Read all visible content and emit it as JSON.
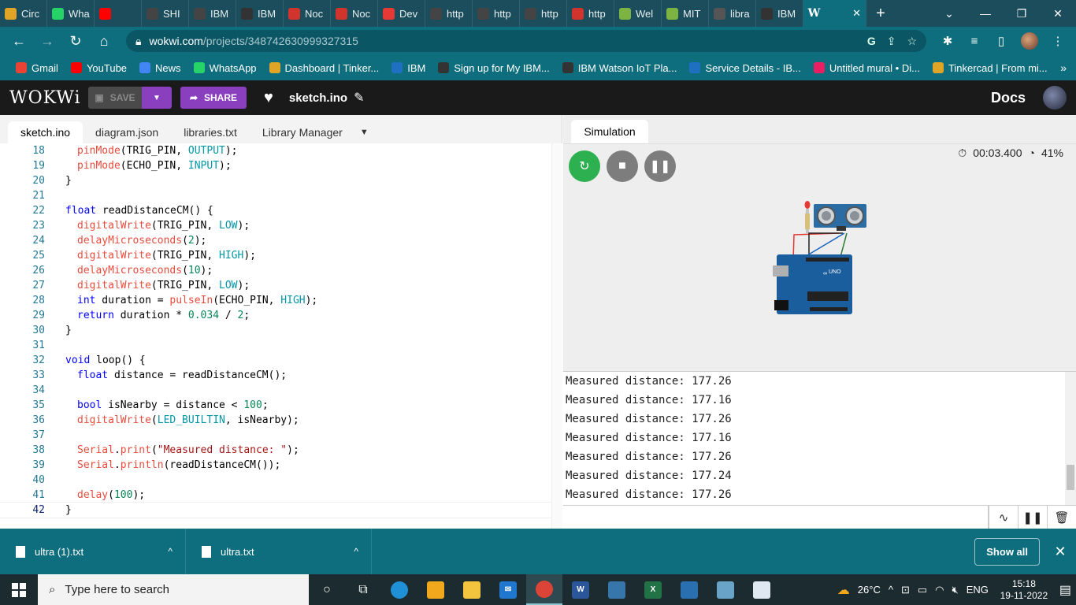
{
  "browser": {
    "tabs": [
      {
        "label": "Circ",
        "color": "#e0a526",
        "icon": "tinkercad-icon"
      },
      {
        "label": "Wha",
        "color": "#25d366",
        "icon": "whatsapp-icon"
      },
      {
        "label": "",
        "color": "#ff0000",
        "icon": "youtube-icon"
      },
      {
        "label": "SHI",
        "color": "#444",
        "icon": "globe-icon"
      },
      {
        "label": "IBM",
        "color": "#444",
        "icon": "globe-icon"
      },
      {
        "label": "IBM",
        "color": "#333",
        "icon": "ibm-watson-icon"
      },
      {
        "label": "Noc",
        "color": "#d0342c",
        "icon": "nodered-icon"
      },
      {
        "label": "Noc",
        "color": "#d0342c",
        "icon": "nodered-icon"
      },
      {
        "label": "Dev",
        "color": "#e53935",
        "icon": "dev-icon"
      },
      {
        "label": "http",
        "color": "#444",
        "icon": "globe-icon"
      },
      {
        "label": "http",
        "color": "#444",
        "icon": "globe-icon"
      },
      {
        "label": "http",
        "color": "#444",
        "icon": "globe-icon"
      },
      {
        "label": "http",
        "color": "#d0342c",
        "icon": "nodered-icon"
      },
      {
        "label": "Wel",
        "color": "#7cb342",
        "icon": "mit-app-icon"
      },
      {
        "label": "MIT",
        "color": "#7cb342",
        "icon": "mit-app-icon"
      },
      {
        "label": "libra",
        "color": "#555",
        "icon": "github-icon"
      },
      {
        "label": "IBM",
        "color": "#333",
        "icon": "ibm-watson-icon"
      }
    ],
    "active_tab": {
      "label": "W",
      "close": "✕"
    },
    "new_tab": "+",
    "window_controls": [
      "⌄",
      "—",
      "❐",
      "✕"
    ],
    "url_host": "wokwi.com",
    "url_path": "/projects/348742630999327315",
    "bookmarks": [
      {
        "label": "Gmail",
        "color": "#ea4335",
        "icon": "gmail-icon"
      },
      {
        "label": "YouTube",
        "color": "#ff0000",
        "icon": "youtube-icon"
      },
      {
        "label": "News",
        "color": "#4285f4",
        "icon": "news-icon"
      },
      {
        "label": "WhatsApp",
        "color": "#25d366",
        "icon": "whatsapp-icon"
      },
      {
        "label": "Dashboard | Tinker...",
        "color": "#e0a526",
        "icon": "tinkercad-icon"
      },
      {
        "label": "IBM",
        "color": "#1f70c1",
        "icon": "ibm-icon"
      },
      {
        "label": "Sign up for My IBM...",
        "color": "#333",
        "icon": "ibm-watson-icon"
      },
      {
        "label": "IBM Watson IoT Pla...",
        "color": "#333",
        "icon": "ibm-watson-icon"
      },
      {
        "label": "Service Details - IB...",
        "color": "#1f70c1",
        "icon": "ibm-cloud-icon"
      },
      {
        "label": "Untitled mural • Di...",
        "color": "#e91e63",
        "icon": "mural-icon"
      },
      {
        "label": "Tinkercad | From mi...",
        "color": "#e0a526",
        "icon": "tinkercad-icon"
      }
    ]
  },
  "wokwi": {
    "logo": "WOKWi",
    "save": "SAVE",
    "share": "SHARE",
    "sketch_name": "sketch.ino",
    "docs": "Docs"
  },
  "editor": {
    "tabs": [
      "sketch.ino",
      "diagram.json",
      "libraries.txt",
      "Library Manager"
    ],
    "lines": [
      {
        "n": "18",
        "code": "pinMode(TRIG_PIN, OUTPUT);"
      },
      {
        "n": "19",
        "code": "pinMode(ECHO_PIN, INPUT);"
      },
      {
        "n": "20",
        "code": "}"
      },
      {
        "n": "21",
        "code": ""
      },
      {
        "n": "22",
        "code": "float readDistanceCM() {"
      },
      {
        "n": "23",
        "code": "digitalWrite(TRIG_PIN, LOW);"
      },
      {
        "n": "24",
        "code": "delayMicroseconds(2);"
      },
      {
        "n": "25",
        "code": "digitalWrite(TRIG_PIN, HIGH);"
      },
      {
        "n": "26",
        "code": "delayMicroseconds(10);"
      },
      {
        "n": "27",
        "code": "digitalWrite(TRIG_PIN, LOW);"
      },
      {
        "n": "28",
        "code": "int duration = pulseIn(ECHO_PIN, HIGH);"
      },
      {
        "n": "29",
        "code": "return duration * 0.034 / 2;"
      },
      {
        "n": "30",
        "code": "}"
      },
      {
        "n": "31",
        "code": ""
      },
      {
        "n": "32",
        "code": "void loop() {"
      },
      {
        "n": "33",
        "code": "float distance = readDistanceCM();"
      },
      {
        "n": "34",
        "code": ""
      },
      {
        "n": "35",
        "code": "bool isNearby = distance < 100;"
      },
      {
        "n": "36",
        "code": "digitalWrite(LED_BUILTIN, isNearby);"
      },
      {
        "n": "37",
        "code": ""
      },
      {
        "n": "38",
        "code": "Serial.print(\"Measured distance: \");"
      },
      {
        "n": "39",
        "code": "Serial.println(readDistanceCM());"
      },
      {
        "n": "40",
        "code": ""
      },
      {
        "n": "41",
        "code": "delay(100);"
      },
      {
        "n": "42",
        "code": "}"
      }
    ]
  },
  "simulation": {
    "tab": "Simulation",
    "time": "00:03.400",
    "speed": "41%",
    "board_label": "UNO"
  },
  "serial": {
    "lines": [
      "Measured distance: 177.26",
      "Measured distance: 177.16",
      "Measured distance: 177.26",
      "Measured distance: 177.16",
      "Measured distance: 177.26",
      "Measured distance: 177.24",
      "Measured distance: 177.26"
    ]
  },
  "downloads": {
    "items": [
      "ultra (1).txt",
      "ultra.txt"
    ],
    "show_all": "Show all"
  },
  "taskbar": {
    "search_placeholder": "Type here to search",
    "weather": "26°C",
    "language": "ENG",
    "time": "15:18",
    "date": "19-11-2022"
  }
}
